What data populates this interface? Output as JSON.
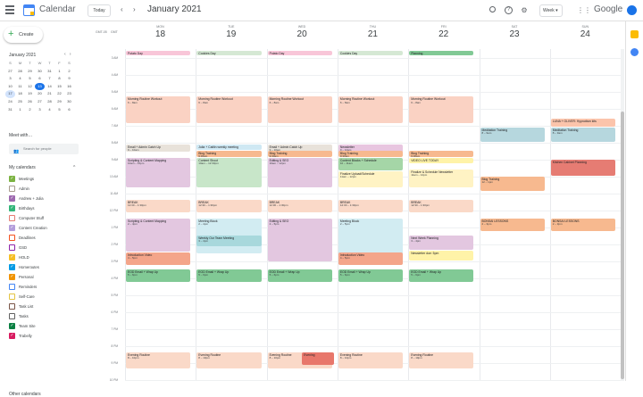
{
  "topbar": {
    "app_title": "Calendar",
    "today_label": "Today",
    "month_title": "January 2021",
    "view_label": "Week",
    "google_label": "Google"
  },
  "colors": {
    "brand_blue": "#1a73e8",
    "accent_green": "#34a853"
  },
  "icons": [
    "menu-icon",
    "calendar-logo-icon",
    "prev-icon",
    "next-icon",
    "search-icon",
    "help-icon",
    "gear-icon",
    "apps-icon",
    "plus-icon",
    "people-icon"
  ],
  "sidebar": {
    "create_label": "Create",
    "mini_month": "January 2021",
    "mini_dow": [
      "S",
      "M",
      "T",
      "W",
      "T",
      "F",
      "S"
    ],
    "mini_days": [
      "27",
      "28",
      "29",
      "30",
      "31",
      "1",
      "2",
      "3",
      "4",
      "5",
      "6",
      "7",
      "8",
      "9",
      "10",
      "11",
      "12",
      "13",
      "14",
      "15",
      "16",
      "17",
      "18",
      "19",
      "20",
      "21",
      "22",
      "23",
      "24",
      "25",
      "26",
      "27",
      "28",
      "29",
      "30",
      "31",
      "1",
      "2",
      "3",
      "4",
      "5",
      "6"
    ],
    "meet_with": "Meet with…",
    "search_people": "Search for people",
    "my_calendars": "My calendars",
    "other_calendars": "Other calendars",
    "calendars": [
      {
        "name": "Meetings",
        "color": "#7cb342",
        "checked": true
      },
      {
        "name": "Admin",
        "color": "#a79b8e",
        "checked": false
      },
      {
        "name": "Andrew + Julia",
        "color": "#9e69af",
        "checked": true
      },
      {
        "name": "Birthdays",
        "color": "#33b679",
        "checked": true
      },
      {
        "name": "Computer Stuff",
        "color": "#e67c73",
        "checked": false
      },
      {
        "name": "Content Creation",
        "color": "#b39ddb",
        "checked": true
      },
      {
        "name": "Deadlines",
        "color": "#f4511e",
        "checked": false
      },
      {
        "name": "GSD",
        "color": "#8e24aa",
        "checked": false
      },
      {
        "name": "HOLD",
        "color": "#f6bf26",
        "checked": true
      },
      {
        "name": "Homeroutes",
        "color": "#039be5",
        "checked": true
      },
      {
        "name": "Personal",
        "color": "#f09300",
        "checked": true
      },
      {
        "name": "Reminders",
        "color": "#4285f4",
        "checked": false
      },
      {
        "name": "Self-Care",
        "color": "#e4c441",
        "checked": false
      },
      {
        "name": "Task List",
        "color": "#795548",
        "checked": false
      },
      {
        "name": "Tasks",
        "color": "#616161",
        "checked": false
      },
      {
        "name": "Team Site",
        "color": "#0b8043",
        "checked": true
      },
      {
        "name": "Trabelly",
        "color": "#d81b60",
        "checked": true
      }
    ]
  },
  "week": {
    "tz_left": "GMT-05",
    "tz_right": "GMT",
    "days": [
      {
        "dow": "MON",
        "num": "18"
      },
      {
        "dow": "TUE",
        "num": "19"
      },
      {
        "dow": "WED",
        "num": "20"
      },
      {
        "dow": "THU",
        "num": "21"
      },
      {
        "dow": "FRI",
        "num": "22"
      },
      {
        "dow": "SAT",
        "num": "23"
      },
      {
        "dow": "SUN",
        "num": "24"
      }
    ],
    "time_labels": [
      "3 AM",
      "4 AM",
      "5 AM",
      "6 AM",
      "7 AM",
      "8 AM",
      "9 AM",
      "10 AM",
      "11 AM",
      "12 PM",
      "1 PM",
      "2 PM",
      "3 PM",
      "4 PM",
      "5 PM",
      "6 PM",
      "7 PM",
      "8 PM",
      "9 PM",
      "10 PM"
    ]
  },
  "events": [
    {
      "day": 0,
      "start": 0,
      "end": 0.3,
      "title": "Potato Day",
      "sub": "",
      "color": "#f8c6d8"
    },
    {
      "day": 1,
      "start": 0,
      "end": 0.3,
      "title": "Cookies Day",
      "sub": "",
      "color": "#d5e8d4"
    },
    {
      "day": 2,
      "start": 0,
      "end": 0.3,
      "title": "Potato Day",
      "sub": "",
      "color": "#f8c6d8"
    },
    {
      "day": 3,
      "start": 0,
      "end": 0.3,
      "title": "Cookies Day",
      "sub": "",
      "color": "#d5e8d4"
    },
    {
      "day": 4,
      "start": 0,
      "end": 0.3,
      "title": "Planning",
      "sub": "",
      "color": "#81c995"
    },
    {
      "day": 0,
      "start": 2.7,
      "end": 4.3,
      "title": "Morning Routine Workout",
      "sub": "6 – 8am",
      "color": "#fad2c3"
    },
    {
      "day": 1,
      "start": 2.7,
      "end": 4.3,
      "title": "Morning Routine Workout",
      "sub": "6 – 8am",
      "color": "#fad2c3"
    },
    {
      "day": 2,
      "start": 2.7,
      "end": 4.3,
      "title": "Morning Routine Workout",
      "sub": "6 – 8am",
      "color": "#fad2c3"
    },
    {
      "day": 3,
      "start": 2.7,
      "end": 4.3,
      "title": "Morning Routine Workout",
      "sub": "6 – 8am",
      "color": "#fad2c3"
    },
    {
      "day": 4,
      "start": 2.7,
      "end": 4.3,
      "title": "Morning Routine Workout",
      "sub": "6 – 8am",
      "color": "#fad2c3"
    },
    {
      "day": 5,
      "start": 4.5,
      "end": 5.4,
      "title": "Meditation Training",
      "sub": "8 – 9am",
      "color": "#b6d7de"
    },
    {
      "day": 6,
      "start": 4.0,
      "end": 4.5,
      "title": "LUNA + OLIVER: Hypnotism kits",
      "sub": "",
      "color": "#fbc4ab"
    },
    {
      "day": 6,
      "start": 4.5,
      "end": 5.4,
      "title": "Meditation Training",
      "sub": "8 – 9am",
      "color": "#b6d7de"
    },
    {
      "day": 0,
      "start": 5.5,
      "end": 6.0,
      "title": "Email + Admin Catch Up",
      "sub": "9 – 10am",
      "color": "#e8e2da"
    },
    {
      "day": 1,
      "start": 5.5,
      "end": 5.9,
      "title": "Julia + Caitlin weekly meeting",
      "sub": "",
      "color": "#cfe8f3"
    },
    {
      "day": 1,
      "start": 5.9,
      "end": 6.3,
      "title": "Blog Training",
      "sub": "9:30am",
      "color": "#f7b98f"
    },
    {
      "day": 2,
      "start": 5.5,
      "end": 6.0,
      "title": "Email + Admin Catch Up",
      "sub": "9 – 10am",
      "color": "#e8e2da"
    },
    {
      "day": 2,
      "start": 5.9,
      "end": 6.3,
      "title": "Blog Training",
      "sub": "9:30am",
      "color": "#f7b98f"
    },
    {
      "day": 3,
      "start": 5.5,
      "end": 6.1,
      "title": "Newsletter",
      "sub": "9 – 10am",
      "color": "#e8c6e0"
    },
    {
      "day": 3,
      "start": 5.9,
      "end": 6.3,
      "title": "Blog Training",
      "sub": "9:30am",
      "color": "#f7b98f"
    },
    {
      "day": 4,
      "start": 5.9,
      "end": 6.3,
      "title": "Blog Training",
      "sub": "9:30am",
      "color": "#f7b98f"
    },
    {
      "day": 4,
      "start": 6.3,
      "end": 6.7,
      "title": "VIDEO LIVE TODAY",
      "sub": "",
      "color": "#fff3a8"
    },
    {
      "day": 0,
      "start": 6.3,
      "end": 8.1,
      "title": "Scripting & Content Mapping",
      "sub": "10am – 12pm",
      "color": "#e3c7e0"
    },
    {
      "day": 1,
      "start": 6.3,
      "end": 8.1,
      "title": "Content Shoot",
      "sub": "10am – 12:30pm",
      "color": "#c8e6c9"
    },
    {
      "day": 2,
      "start": 6.3,
      "end": 8.1,
      "title": "Editing & SEO",
      "sub": "10am – 12pm",
      "color": "#e3c7e0"
    },
    {
      "day": 3,
      "start": 6.3,
      "end": 7.1,
      "title": "Content Blocks + Schedule",
      "sub": "10 – 11am",
      "color": "#a5d6a7"
    },
    {
      "day": 3,
      "start": 7.1,
      "end": 8.1,
      "title": "Finalize Upload/Schedule",
      "sub": "11am – 12pm",
      "color": "#fff3c4"
    },
    {
      "day": 4,
      "start": 7.0,
      "end": 8.1,
      "title": "Finalize & Schedule Newsletter",
      "sub": "11am – 12pm",
      "color": "#fff3c4"
    },
    {
      "day": 5,
      "start": 7.4,
      "end": 8.3,
      "title": "Blog Training",
      "sub": "12 – 1pm",
      "color": "#f7b98f"
    },
    {
      "day": 6,
      "start": 6.4,
      "end": 7.4,
      "title": "Kitchen Cabinet Planning",
      "sub": "",
      "color": "#e67c73"
    },
    {
      "day": 0,
      "start": 8.8,
      "end": 9.6,
      "title": "BREAK",
      "sub": "12:30 – 1:30pm",
      "color": "#fad9c8"
    },
    {
      "day": 1,
      "start": 8.8,
      "end": 9.6,
      "title": "BREAK",
      "sub": "12:30 – 1:30pm",
      "color": "#fad9c8"
    },
    {
      "day": 2,
      "start": 8.8,
      "end": 9.6,
      "title": "BREAK",
      "sub": "12:30 – 1:30pm",
      "color": "#fad9c8"
    },
    {
      "day": 3,
      "start": 8.8,
      "end": 9.6,
      "title": "BREAK",
      "sub": "12:30 – 1:30pm",
      "color": "#fad9c8"
    },
    {
      "day": 4,
      "start": 8.8,
      "end": 9.6,
      "title": "BREAK",
      "sub": "12:30 – 1:30pm",
      "color": "#fad9c8"
    },
    {
      "day": 0,
      "start": 9.9,
      "end": 11.9,
      "title": "Scripting & Content Mapping",
      "sub": "2 – 4pm",
      "color": "#e3c7e0"
    },
    {
      "day": 1,
      "start": 9.9,
      "end": 12.0,
      "title": "Meeting Block",
      "sub": "2 – 4pm",
      "color": "#d2ecf2"
    },
    {
      "day": 1,
      "start": 10.9,
      "end": 11.6,
      "title": "Weekly Our Team Meeting",
      "sub": "3 – 4pm",
      "color": "#a8d8dc"
    },
    {
      "day": 2,
      "start": 9.9,
      "end": 12.5,
      "title": "Editing & SEO",
      "sub": "2 – 5pm",
      "color": "#e3c7e0"
    },
    {
      "day": 3,
      "start": 9.9,
      "end": 12.5,
      "title": "Meeting Block",
      "sub": "2 – 5pm",
      "color": "#d2ecf2"
    },
    {
      "day": 4,
      "start": 10.9,
      "end": 11.8,
      "title": "Next Week Planning",
      "sub": "3 – 4pm",
      "color": "#e3c7e0"
    },
    {
      "day": 4,
      "start": 11.8,
      "end": 12.4,
      "title": "Newsletter due: 5pm",
      "sub": "",
      "color": "#fff3a8"
    },
    {
      "day": 5,
      "start": 9.9,
      "end": 10.7,
      "title": "BONSAI LESSONS",
      "sub": "2 – 3pm",
      "color": "#f7b98f"
    },
    {
      "day": 6,
      "start": 9.9,
      "end": 10.7,
      "title": "BONSAI LESSONS",
      "sub": "2 – 3pm",
      "color": "#f7b98f"
    },
    {
      "day": 0,
      "start": 11.9,
      "end": 12.7,
      "title": "Introduction Video",
      "sub": "4 – 5pm",
      "color": "#f4a58a"
    },
    {
      "day": 3,
      "start": 11.9,
      "end": 12.7,
      "title": "Introduction Video",
      "sub": "4 – 5pm",
      "color": "#f4a58a"
    },
    {
      "day": 0,
      "start": 12.9,
      "end": 13.7,
      "title": "EOD Email + Wrap Up",
      "sub": "5 – 6pm",
      "color": "#81c995"
    },
    {
      "day": 1,
      "start": 12.9,
      "end": 13.7,
      "title": "EOD Email + Wrap Up",
      "sub": "5 – 6pm",
      "color": "#81c995"
    },
    {
      "day": 2,
      "start": 12.9,
      "end": 13.7,
      "title": "EOD Email + Wrap Up",
      "sub": "5 – 6pm",
      "color": "#81c995"
    },
    {
      "day": 3,
      "start": 12.9,
      "end": 13.7,
      "title": "EOD Email + Wrap Up",
      "sub": "5 – 6pm",
      "color": "#81c995"
    },
    {
      "day": 4,
      "start": 12.9,
      "end": 13.7,
      "title": "EOD Email + Wrap Up",
      "sub": "5 – 6pm",
      "color": "#81c995"
    },
    {
      "day": 0,
      "start": 17.8,
      "end": 18.8,
      "title": "Evening Routine",
      "sub": "8 – 10pm",
      "color": "#fad9c8"
    },
    {
      "day": 1,
      "start": 17.8,
      "end": 18.8,
      "title": "Evening Routine",
      "sub": "8 – 10pm",
      "color": "#fad9c8"
    },
    {
      "day": 2,
      "start": 17.8,
      "end": 18.8,
      "title": "Evening Routine",
      "sub": "8 – 10pm",
      "color": "#fad9c8"
    },
    {
      "day": 2,
      "start": 17.8,
      "end": 18.6,
      "title": "Evening",
      "sub": "",
      "color": "#e8776b",
      "half": true
    },
    {
      "day": 3,
      "start": 17.8,
      "end": 18.8,
      "title": "Evening Routine",
      "sub": "8 – 10pm",
      "color": "#fad9c8"
    },
    {
      "day": 4,
      "start": 17.8,
      "end": 18.8,
      "title": "Evening Routine",
      "sub": "8 – 10pm",
      "color": "#fad9c8"
    }
  ]
}
